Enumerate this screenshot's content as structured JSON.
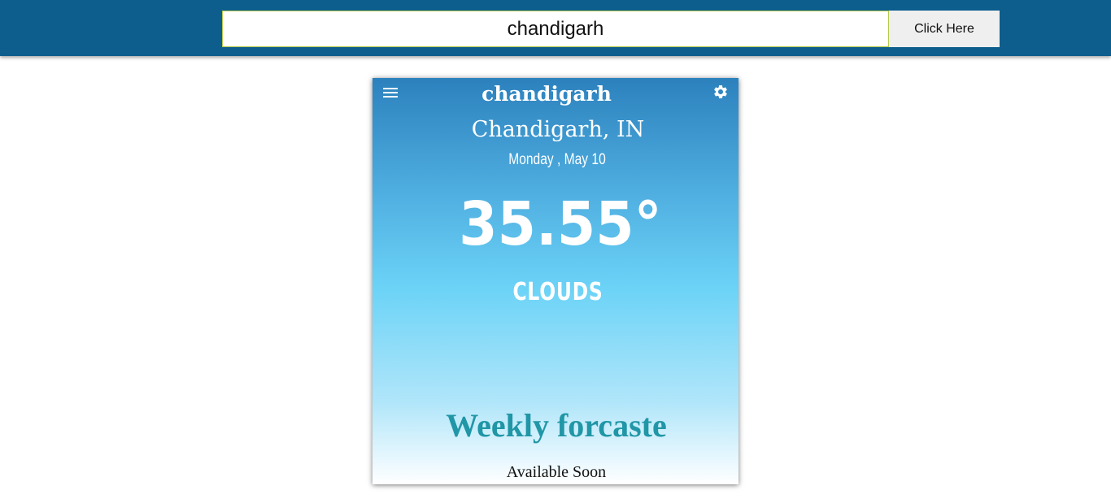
{
  "search": {
    "value": "chandigarh",
    "button_label": "Click Here"
  },
  "card": {
    "title": "chandigarh",
    "location": "Chandigarh, IN",
    "date": "Monday , May 10",
    "temperature": "35.55°",
    "condition": "CLOUDS",
    "weekly_title": "Weekly forcaste",
    "weekly_subtitle": "Available Soon",
    "icons": {
      "menu": "menu-icon",
      "settings": "gear-icon"
    }
  },
  "colors": {
    "topbar": "#0d5e8d",
    "card_top": "#2c81bd",
    "card_mid": "#6cd3f7",
    "weekly_title": "#2096a6"
  }
}
